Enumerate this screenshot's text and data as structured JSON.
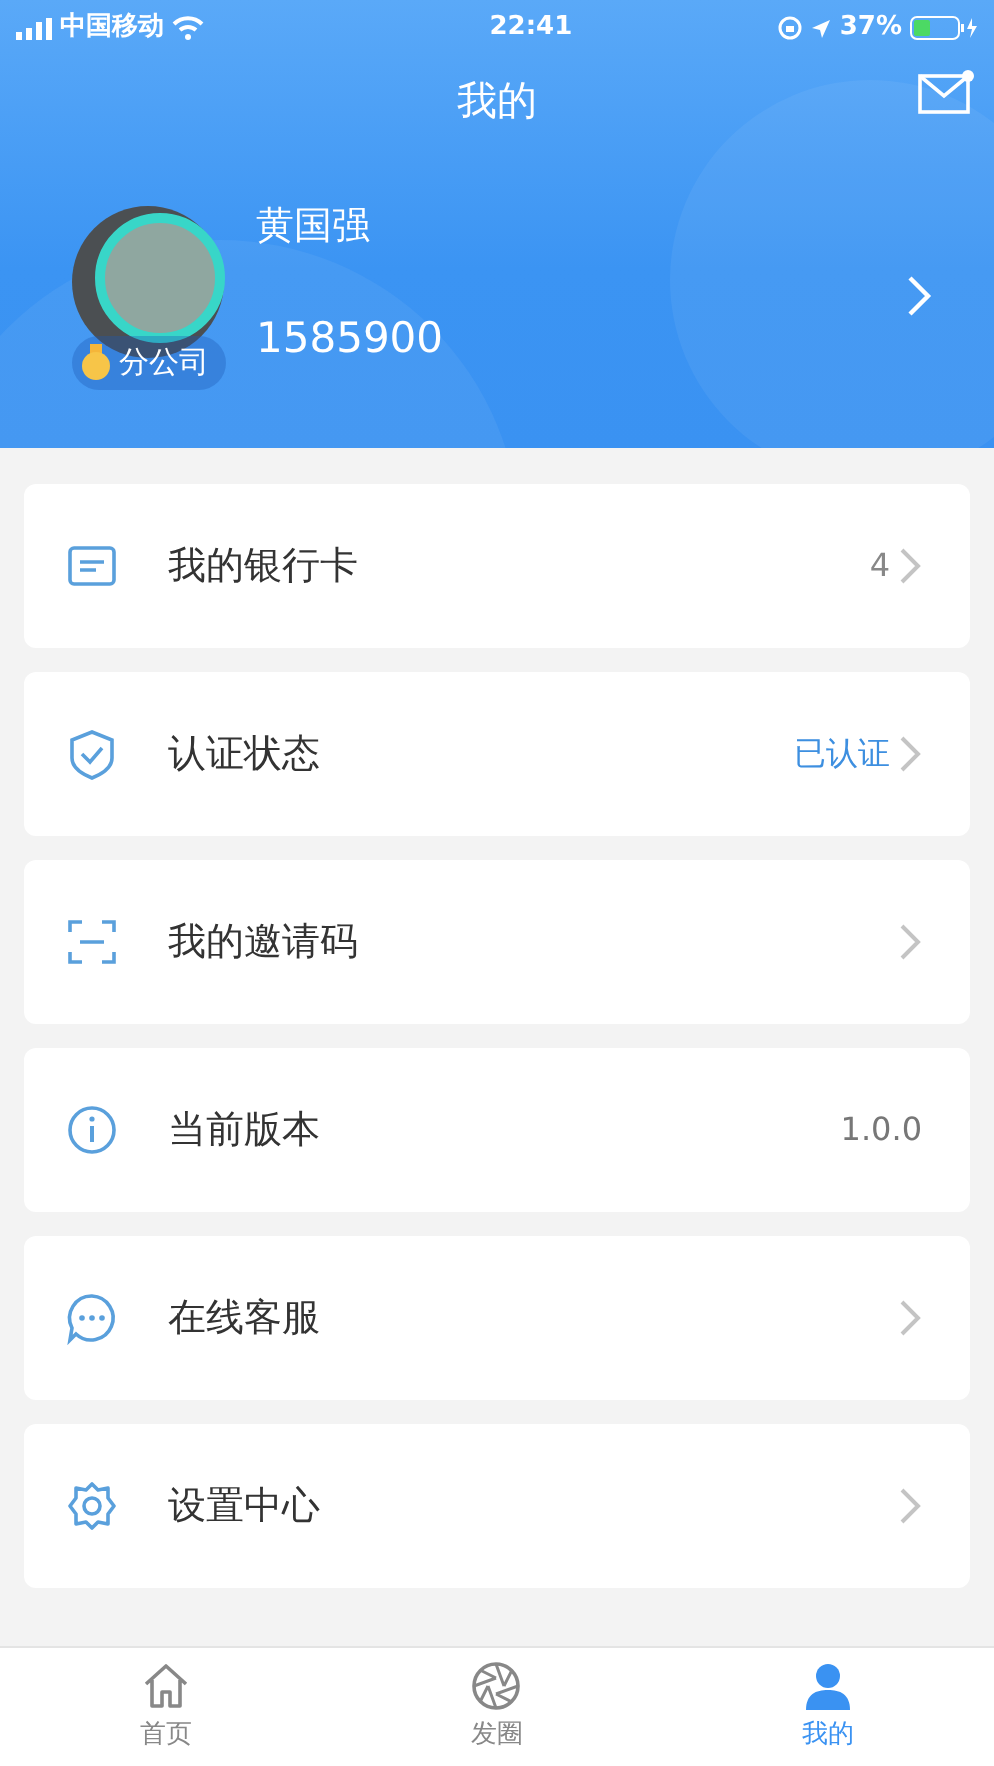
{
  "status_bar": {
    "carrier": "中国移动",
    "time": "22:41",
    "battery": "37%"
  },
  "header": {
    "title": "我的",
    "has_unread_mail": true
  },
  "profile": {
    "name": "黄国强",
    "id": "1585900",
    "badge": "分公司"
  },
  "menu": [
    {
      "label": "我的银行卡",
      "kind": "count",
      "value": "4",
      "chevron": true
    },
    {
      "label": "认证状态",
      "kind": "status",
      "value": "已认证",
      "chevron": true
    },
    {
      "label": "我的邀请码",
      "kind": "plain",
      "chevron": true
    },
    {
      "label": "当前版本",
      "kind": "info",
      "value": "1.0.0",
      "chevron": false
    },
    {
      "label": "在线客服",
      "kind": "plain",
      "chevron": true
    },
    {
      "label": "设置中心",
      "kind": "plain",
      "chevron": true
    }
  ],
  "tab_bar": [
    {
      "label": "首页",
      "selected": false
    },
    {
      "label": "发圈",
      "selected": false
    },
    {
      "label": "我的",
      "selected": true
    }
  ]
}
